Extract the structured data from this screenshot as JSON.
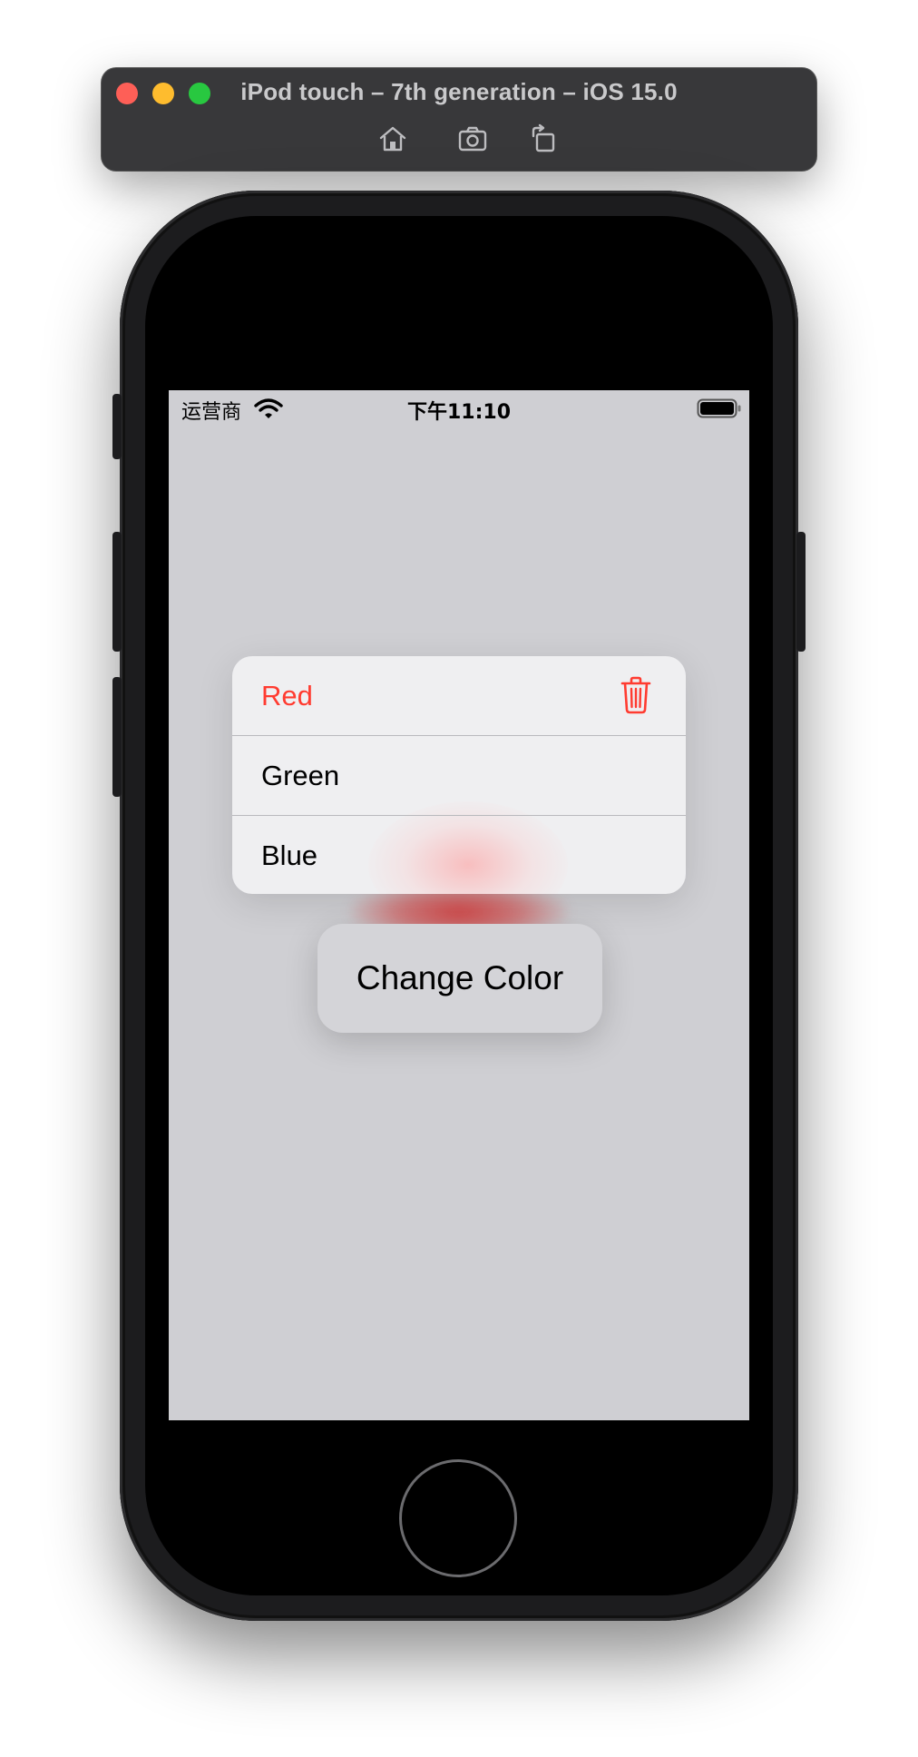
{
  "simulator": {
    "title": "iPod touch – 7th generation – iOS 15.0",
    "toolbar": [
      "home-icon",
      "screenshot-icon",
      "rotate-icon"
    ]
  },
  "status_bar": {
    "carrier": "运营商",
    "time": "下午11:10"
  },
  "menu": {
    "items": [
      {
        "label": "Red",
        "color": "#ff3b30",
        "icon": "trash-icon"
      },
      {
        "label": "Green"
      },
      {
        "label": "Blue"
      }
    ]
  },
  "button": {
    "label": "Change Color"
  },
  "colors": {
    "screen_background": "#cfcfd3",
    "destructive": "#ff3b30",
    "menu_background": "#efeff1"
  }
}
